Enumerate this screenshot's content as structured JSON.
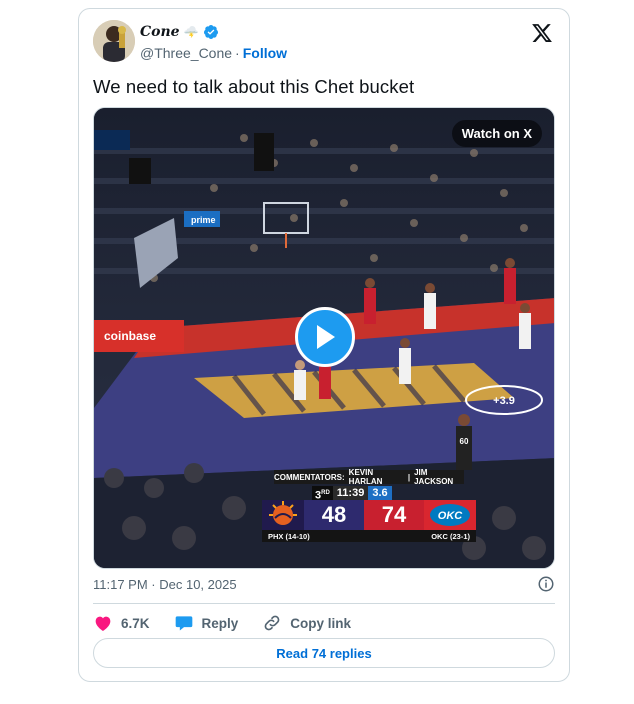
{
  "author": {
    "display_name": "Cone",
    "emoji": "🌩️",
    "handle": "@Three_Cone",
    "separator": "·",
    "follow_label": "Follow"
  },
  "tweet": {
    "text": "We need to talk about this Chet bucket"
  },
  "media": {
    "watch_label": "Watch on X",
    "broadcast": {
      "commentators_label": "COMMENTATORS:",
      "commentator_1": "KEVIN HARLAN",
      "commentator_sep": "|",
      "commentator_2": "JIM JACKSON",
      "period_num": "3",
      "period_suffix": "RD",
      "game_clock": "11:39",
      "shot_clock": "3.6",
      "away_abbr": "PHX",
      "away_record": "(14-10)",
      "away_score": "48",
      "home_abbr": "OKC",
      "home_record": "(23-1)",
      "home_score": "74",
      "home_logo_text": "OKC",
      "court_text": "+3.9",
      "ad_1": "coinbase",
      "ad_2": "prime",
      "jersey": "60"
    }
  },
  "meta": {
    "timestamp": "11:17 PM · Dec 10, 2025"
  },
  "actions": {
    "likes": "6.7K",
    "reply_label": "Reply",
    "copy_link_label": "Copy link",
    "read_replies_label": "Read 74 replies"
  },
  "colors": {
    "link_blue": "#006fd6",
    "verified_blue": "#1d9bf0",
    "like_pink": "#f91880",
    "text_gray": "#536471",
    "border": "#cfd9de"
  }
}
